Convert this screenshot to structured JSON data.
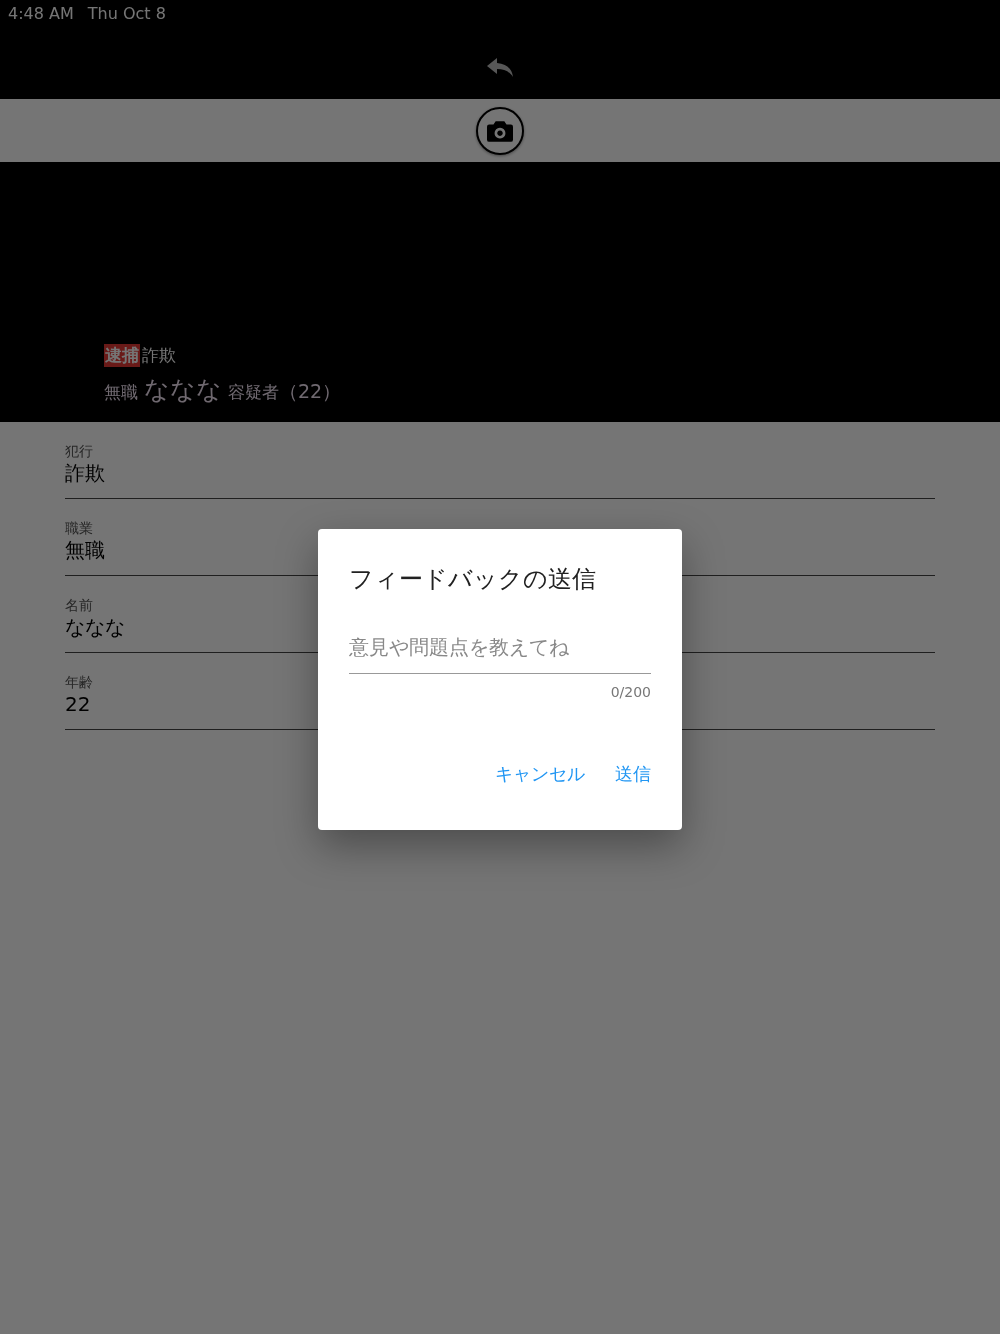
{
  "status_bar": {
    "time": "4:48 AM",
    "date": "Thu Oct 8"
  },
  "header": {
    "badge": "逮捕",
    "crime": "詐欺",
    "occupation": "無職",
    "name": "ななな",
    "role": "容疑者",
    "age": "（22）"
  },
  "fields": [
    {
      "label": "犯行",
      "value": "詐欺"
    },
    {
      "label": "職業",
      "value": "無職"
    },
    {
      "label": "名前",
      "value": "ななな"
    },
    {
      "label": "年齢",
      "value": "22"
    }
  ],
  "dialog": {
    "title": "フィードバックの送信",
    "placeholder": "意見や問題点を教えてね",
    "counter": "0/200",
    "buttons": [
      "キャンセル",
      "送信"
    ]
  }
}
